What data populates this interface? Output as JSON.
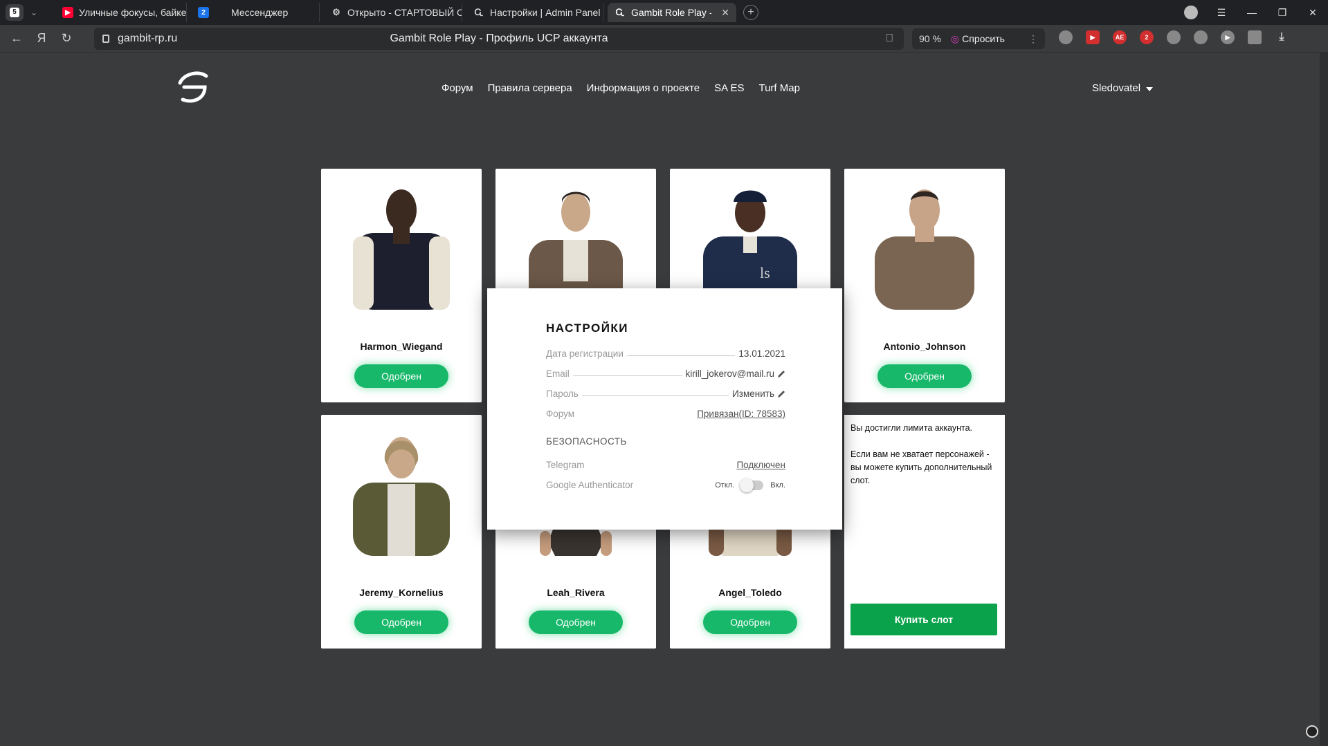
{
  "browser": {
    "tab_count": "5",
    "tabs": [
      {
        "title": "Уличные фокусы, байкер",
        "icon": "youtube-icon",
        "color": "#ff0033"
      },
      {
        "title": "Мессенджер",
        "icon": "messenger-icon",
        "badge": "2",
        "color": "#1a73e8"
      },
      {
        "title": "Открыто - СТАРТОВЫЙ С",
        "icon": "gamepad-icon",
        "color": "#888888"
      },
      {
        "title": "Настройки | Admin Panel",
        "icon": "gambit-icon",
        "color": "#888888"
      },
      {
        "title": "Gambit Role Play - Проф",
        "icon": "gambit-icon",
        "color": "#888888"
      }
    ],
    "url": "gambit-rp.ru",
    "page_title": "Gambit Role Play - Профиль UCP аккаунта",
    "zoom": "90 %",
    "ask_label": "Спросить"
  },
  "site": {
    "nav": [
      "Форум",
      "Правила сервера",
      "Информация о проекте",
      "SA ES",
      "Turf Map"
    ],
    "username": "Sledovatel",
    "characters": [
      {
        "name": "Harmon_Wiegand",
        "status": "Одобрен"
      },
      {
        "name": "",
        "status": ""
      },
      {
        "name": "",
        "status": ""
      },
      {
        "name": "Antonio_Johnson",
        "status": "Одобрен"
      },
      {
        "name": "Jeremy_Kornelius",
        "status": "Одобрен"
      },
      {
        "name": "Leah_Rivera",
        "status": "Одобрен"
      },
      {
        "name": "Angel_Toledo",
        "status": "Одобрен"
      }
    ],
    "limit": {
      "line1": "Вы достигли лимита аккаунта.",
      "line2": "Если вам не хватает персонажей - вы можете купить дополнительный слот.",
      "buy_label": "Купить слот"
    },
    "accent": "#18b86a"
  },
  "settings": {
    "title": "НАСТРОЙКИ",
    "reg_label": "Дата регистрации",
    "reg_value": "13.01.2021",
    "email_label": "Email",
    "email_value": "kirill_jokerov@mail.ru",
    "password_label": "Пароль",
    "password_value": "Изменить",
    "forum_label": "Форум",
    "forum_value": "Привязан(ID: 78583)",
    "security_title": "БЕЗОПАСНОСТЬ",
    "telegram_label": "Telegram",
    "telegram_value": "Подключен",
    "ga_label": "Google Authenticator",
    "toggle_off": "Откл.",
    "toggle_on": "Вкл."
  }
}
